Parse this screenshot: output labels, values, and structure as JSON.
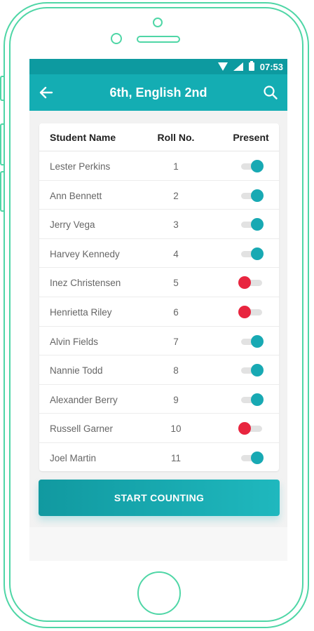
{
  "status_bar": {
    "time": "07:53"
  },
  "app_bar": {
    "title": "6th, English 2nd",
    "back_icon": "arrow-left-icon",
    "search_icon": "search-icon"
  },
  "table": {
    "headers": {
      "name": "Student Name",
      "roll": "Roll No.",
      "present": "Present"
    },
    "rows": [
      {
        "name": "Lester Perkins",
        "roll": "1",
        "present": true
      },
      {
        "name": "Ann Bennett",
        "roll": "2",
        "present": true
      },
      {
        "name": "Jerry Vega",
        "roll": "3",
        "present": true
      },
      {
        "name": "Harvey Kennedy",
        "roll": "4",
        "present": true
      },
      {
        "name": "Inez Christensen",
        "roll": "5",
        "present": false
      },
      {
        "name": "Henrietta Riley",
        "roll": "6",
        "present": false
      },
      {
        "name": "Alvin Fields",
        "roll": "7",
        "present": true
      },
      {
        "name": "Nannie Todd",
        "roll": "8",
        "present": true
      },
      {
        "name": "Alexander Berry",
        "roll": "9",
        "present": true
      },
      {
        "name": "Russell Garner",
        "roll": "10",
        "present": false
      },
      {
        "name": "Joel Martin",
        "roll": "11",
        "present": true
      }
    ]
  },
  "start_button": {
    "label": "START COUNTING"
  },
  "colors": {
    "primary": "#14adb3",
    "status_bar": "#0d9aa0",
    "present_on": "#18a9b3",
    "present_off": "#e8253f",
    "phone_outline": "#4fd6a6"
  }
}
